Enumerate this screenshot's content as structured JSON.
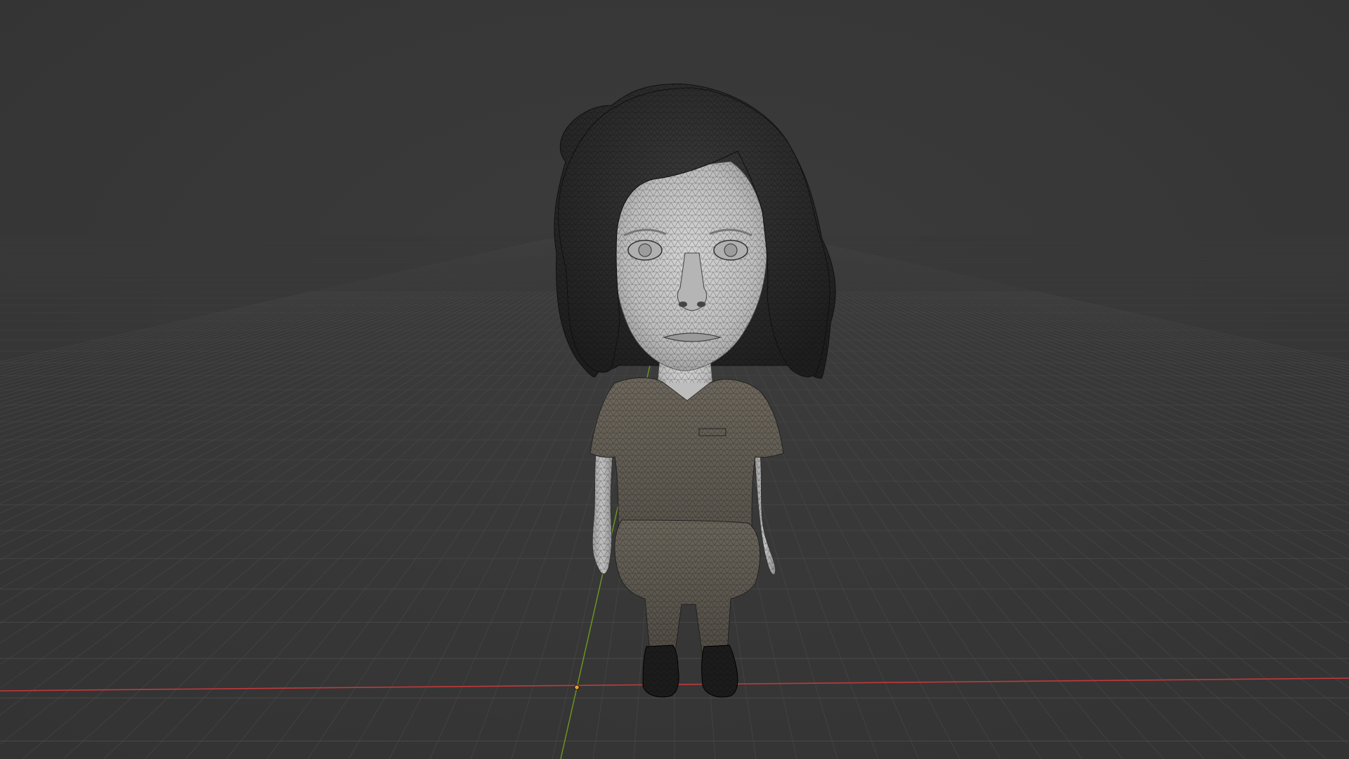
{
  "viewport": {
    "mode": "3d-viewport",
    "shading": "solid-wireframe-overlay",
    "background_color": "#3a3a3a",
    "grid_visible": true,
    "grid_color": "#4d4d4d",
    "x_axis_color": "#c0393b",
    "y_axis_color": "#6c9a1c"
  },
  "scene": {
    "object_icon": "character-mesh-icon",
    "origin_marker_color": "#f0a030"
  }
}
